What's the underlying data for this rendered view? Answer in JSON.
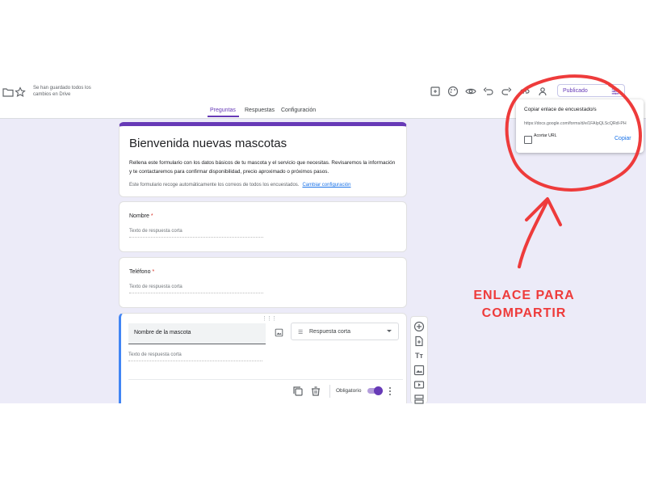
{
  "header": {
    "saved_status": "Se han guardado todos los cambios en Drive",
    "publish_label": "Publicado",
    "icons": [
      "folder-icon",
      "star-icon",
      "addon-icon",
      "palette-icon",
      "eye-icon",
      "undo-icon",
      "redo-icon",
      "link-icon",
      "add-person-icon",
      "tune-icon"
    ]
  },
  "tabs": [
    {
      "label": "Preguntas",
      "active": true
    },
    {
      "label": "Respuestas",
      "active": false
    },
    {
      "label": "Configuración",
      "active": false
    }
  ],
  "form": {
    "title": "Bienvenida nuevas mascotas",
    "description": "Rellena este formulario con los datos básicos de tu mascota y el servicio que necesitas. Revisaremos la información y te contactaremos para confirmar disponibilidad, precio aproximado o próximos pasos.",
    "email_note": "Este formulario recoge automáticamente los correos de todos los encuestados.",
    "change_settings_link": "Cambiar configuración",
    "accent_color": "#673ab7"
  },
  "questions": [
    {
      "label": "Nombre",
      "required_mark": "*",
      "answer_placeholder": "Texto de respuesta corta"
    },
    {
      "label": "Teléfono",
      "required_mark": "*",
      "answer_placeholder": "Texto de respuesta corta"
    },
    {
      "label": "Nombre de la mascota",
      "answer_placeholder": "Texto de respuesta corta",
      "type": "Respuesta corta",
      "required_label": "Obligatorio",
      "required_on": true
    }
  ],
  "popup": {
    "title": "Copiar enlace de encuestado/s",
    "url": "https://docs.google.com/forms/d/e/1FAIpQLScQRdl-PH",
    "shorten_label": "Acortar URL",
    "copy_label": "Copiar"
  },
  "annotation": {
    "line1": "ENLACE PARA",
    "line2": "COMPARTIR",
    "color": "#ee3b3b"
  }
}
